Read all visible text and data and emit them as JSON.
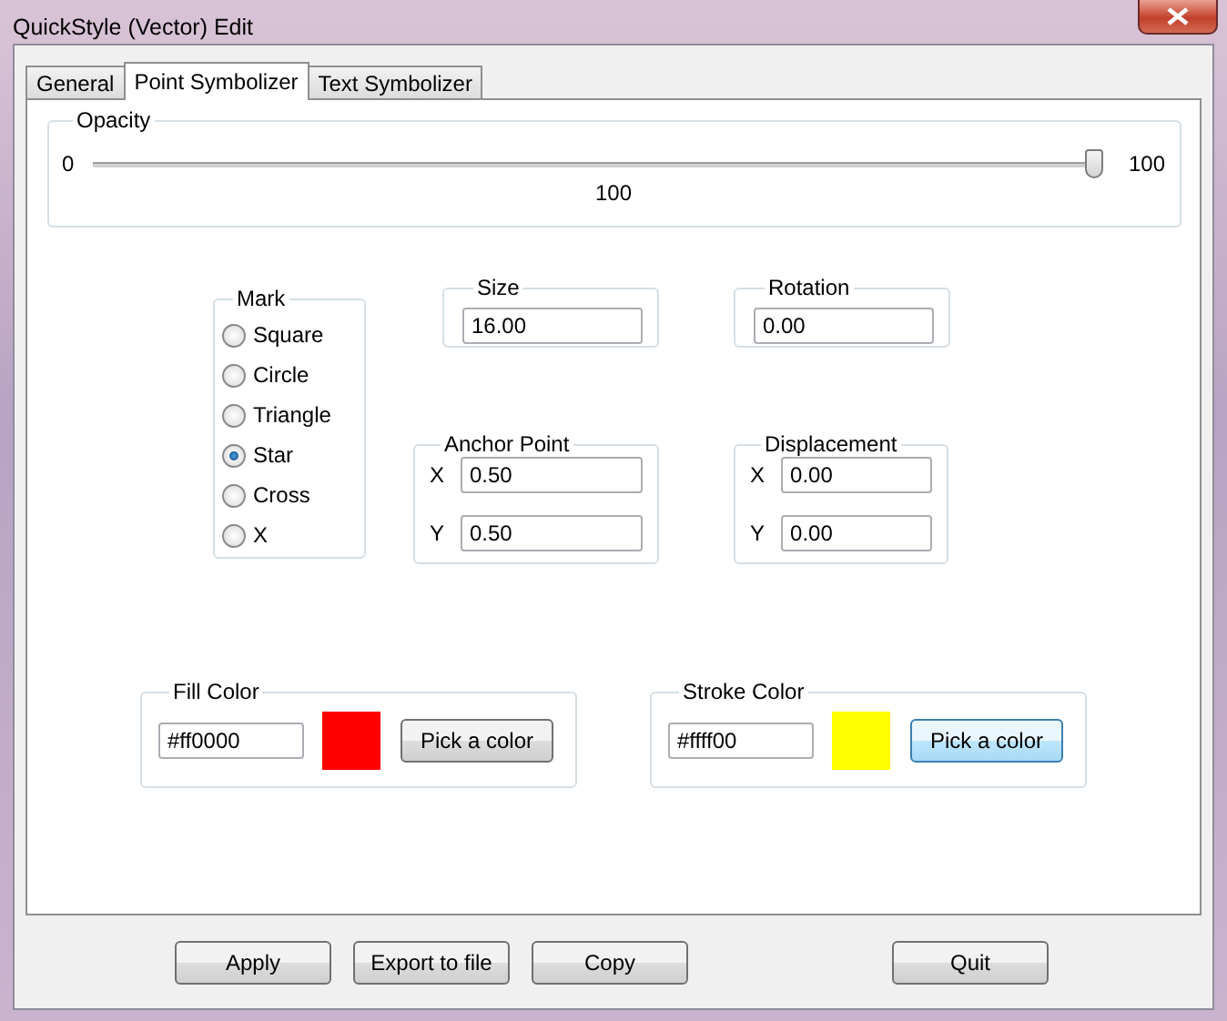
{
  "window": {
    "title": "QuickStyle (Vector) Edit"
  },
  "tabs": [
    {
      "label": "General",
      "selected": false
    },
    {
      "label": "Point Symbolizer",
      "selected": true
    },
    {
      "label": "Text Symbolizer",
      "selected": false
    }
  ],
  "opacity": {
    "label": "Opacity",
    "min_label": "0",
    "max_label": "100",
    "level": 1,
    "value": "100"
  },
  "mark": {
    "label": "Mark",
    "options": [
      {
        "label": "Square",
        "selected": false
      },
      {
        "label": "Circle",
        "selected": false
      },
      {
        "label": "Triangle",
        "selected": false
      },
      {
        "label": "Star",
        "selected": true
      },
      {
        "label": "Cross",
        "selected": false
      },
      {
        "label": "X",
        "selected": false
      }
    ]
  },
  "size": {
    "label": "Size",
    "value": "16.00"
  },
  "rotation": {
    "label": "Rotation",
    "value": "0.00"
  },
  "anchor_point": {
    "label": "Anchor Point",
    "fields": [
      {
        "axis": "X",
        "value": "0.50"
      },
      {
        "axis": "Y",
        "value": "0.50"
      }
    ]
  },
  "displacement": {
    "label": "Displacement",
    "fields": [
      {
        "axis": "X",
        "value": "0.00"
      },
      {
        "axis": "Y",
        "value": "0.00"
      }
    ]
  },
  "fill_color": {
    "label": "Fill Color",
    "value": "#ff0000",
    "color": "#ff0000",
    "button": "Pick a color",
    "focused": false
  },
  "stroke_color": {
    "label": "Stroke Color",
    "value": "#ffff00",
    "color": "#ffff00",
    "button": "Pick a color",
    "focused": true
  },
  "buttons": [
    {
      "label": "Apply"
    },
    {
      "label": "Export to file"
    },
    {
      "label": "Copy"
    },
    {
      "label": "Quit"
    }
  ]
}
